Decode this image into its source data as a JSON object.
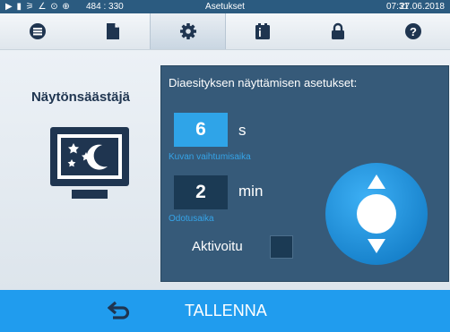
{
  "status_bar": {
    "indicators": "▶ ▮ ⚞ ∠ ⊙ ⊕",
    "coords": "484 : 330",
    "title": "Asetukset",
    "time": "07:31",
    "date": "27.06.2018"
  },
  "tabs": [
    {
      "icon": "list-icon",
      "active": false
    },
    {
      "icon": "document-icon",
      "active": false
    },
    {
      "icon": "gear-icon",
      "active": true
    },
    {
      "icon": "info-device-icon",
      "active": false
    },
    {
      "icon": "lock-icon",
      "active": false
    },
    {
      "icon": "help-icon",
      "active": false
    }
  ],
  "sidebar": {
    "title": "Näytönsäästäjä",
    "icon": "screensaver-monitor-icon"
  },
  "panel": {
    "title": "Diaesityksen näyttämisen asetukset:",
    "slide_interval": {
      "value": "6",
      "unit": "s",
      "label": "Kuvan vaihtumisaika",
      "selected": true
    },
    "wait_time": {
      "value": "2",
      "unit": "min",
      "label": "Odotusaika",
      "selected": false
    },
    "activated": {
      "label": "Aktivoitu",
      "checked": false
    }
  },
  "bottom_bar": {
    "back_icon": "back-arrow-icon",
    "save_label": "TALLENNA"
  },
  "colors": {
    "status_bar": "#2b5b80",
    "panel": "#365a79",
    "accent": "#209cee",
    "selected_field": "#2fa4e8",
    "unselected_field": "#1b3a54",
    "icon_navy": "#1f3550"
  }
}
